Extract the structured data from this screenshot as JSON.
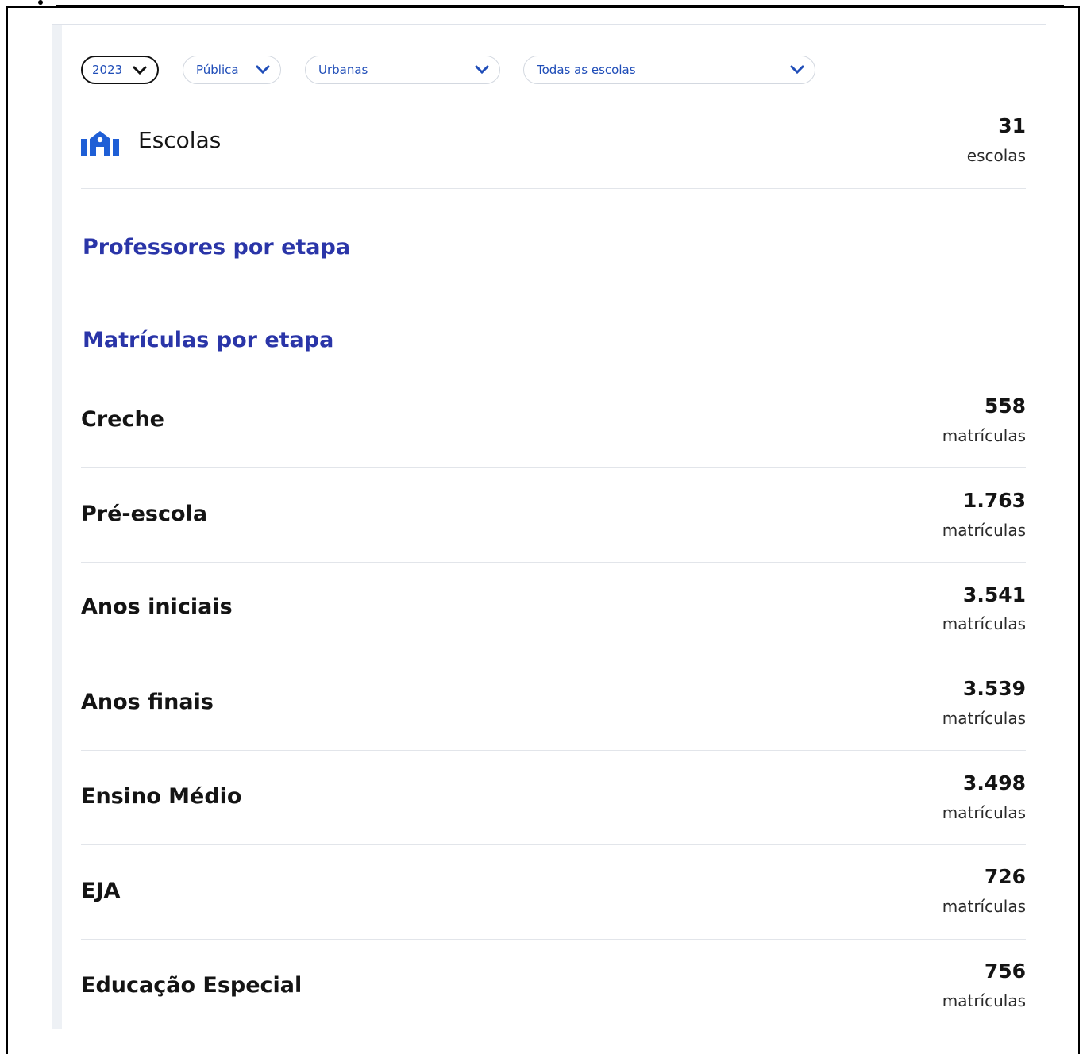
{
  "filters": {
    "year": "2023",
    "network": "Pública",
    "location": "Urbanas",
    "school": "Todas as escolas"
  },
  "schools": {
    "label": "Escolas",
    "value": "31",
    "unit": "escolas",
    "icon": "school-icon"
  },
  "sections": {
    "teachers_title": "Professores por etapa",
    "enrollments_title": "Matrículas por etapa"
  },
  "enrollments": [
    {
      "label": "Creche",
      "value": "558",
      "unit": "matrículas"
    },
    {
      "label": "Pré-escola",
      "value": "1.763",
      "unit": "matrículas"
    },
    {
      "label": "Anos iniciais",
      "value": "3.541",
      "unit": "matrículas"
    },
    {
      "label": "Anos finais",
      "value": "3.539",
      "unit": "matrículas"
    },
    {
      "label": "Ensino Médio",
      "value": "3.498",
      "unit": "matrículas"
    },
    {
      "label": "EJA",
      "value": "726",
      "unit": "matrículas"
    },
    {
      "label": "Educação Especial",
      "value": "756",
      "unit": "matrículas"
    }
  ],
  "colors": {
    "accent": "#1f4db8",
    "title": "#2a35a8"
  }
}
